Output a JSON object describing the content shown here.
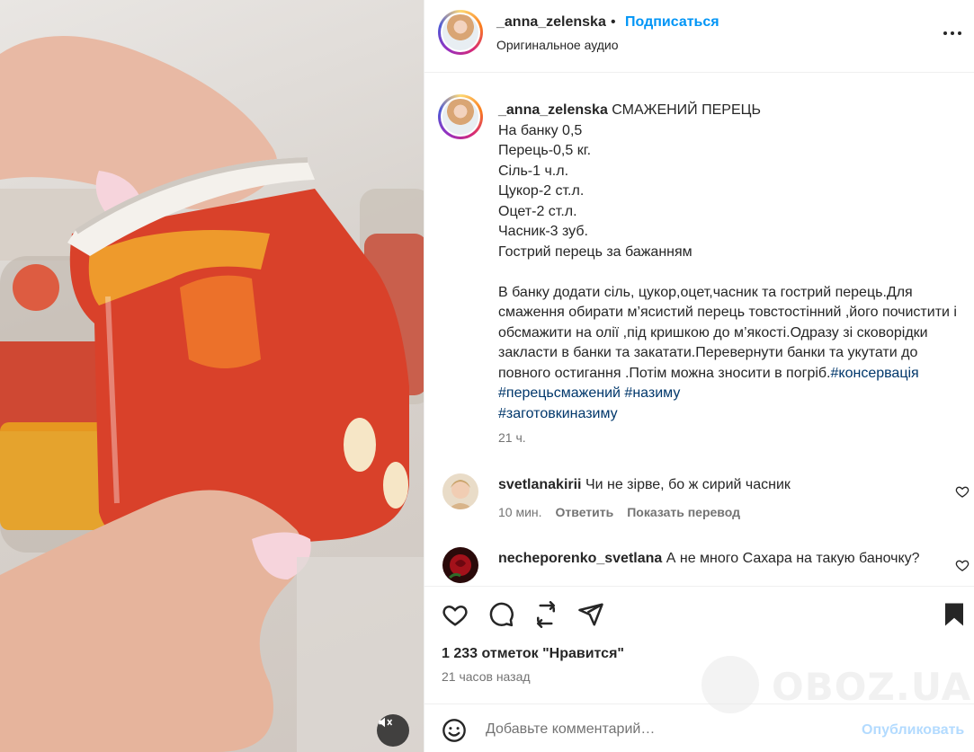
{
  "post": {
    "username": "_anna_zelenska",
    "dot": "•",
    "follow_label": "Подписаться",
    "audio_label": "Оригинальное аудио",
    "more_icon": "more-horizontal-icon"
  },
  "caption": {
    "username": "_anna_zelenska",
    "text": " СМАЖЕНИЙ ПЕРЕЦЬ\nНа банку 0,5\nПерець-0,5 кг.\nСіль-1 ч.л.\nЦукор-2 ст.л.\nОцет-2 ст.л.\nЧасник-3 зуб.\nГострий перець за бажанням\n\nВ банку додати сіль, цукор,оцет,часник та гострий перець.Для смаження обирати м’ясистий перець товстостінний ,його почистити і обсмажити на олії ,під кришкою до м’якості.Одразу зі сковорідки закласти в банки та закатати.Перевернути банки та укутати до повного остигання .Потім можна зносити в погріб.",
    "hashtags": [
      "#консервація",
      "#перецьсмажений",
      "#назиму",
      "#заготовкиназиму"
    ],
    "time": "21 ч."
  },
  "comments": [
    {
      "username": "svetlanakirii",
      "text": " Чи не зірве, бо ж сирий часник",
      "time": "10 мин.",
      "reply_label": "Ответить",
      "translate_label": "Показать перевод"
    },
    {
      "username": "necheporenko_svetlana",
      "text": " А не много Сахара на такую баночку?"
    }
  ],
  "actions": {
    "like_icon": "heart-icon",
    "comment_icon": "comment-icon",
    "repost_icon": "repost-icon",
    "share_icon": "send-icon",
    "save_icon": "bookmark-icon"
  },
  "likes_text": "1 233 отметок \"Нравится\"",
  "posted_ago": "21 часов назад",
  "composer": {
    "placeholder": "Добавьте комментарий…",
    "publish_label": "Опубликовать",
    "emoji_icon": "emoji-icon"
  },
  "watermark": "OBOZ.UA",
  "colors": {
    "link_blue": "#0095f6",
    "hashtag": "#00376b",
    "publish_disabled": "#b3dbff",
    "text": "#262626",
    "muted": "#737373"
  }
}
